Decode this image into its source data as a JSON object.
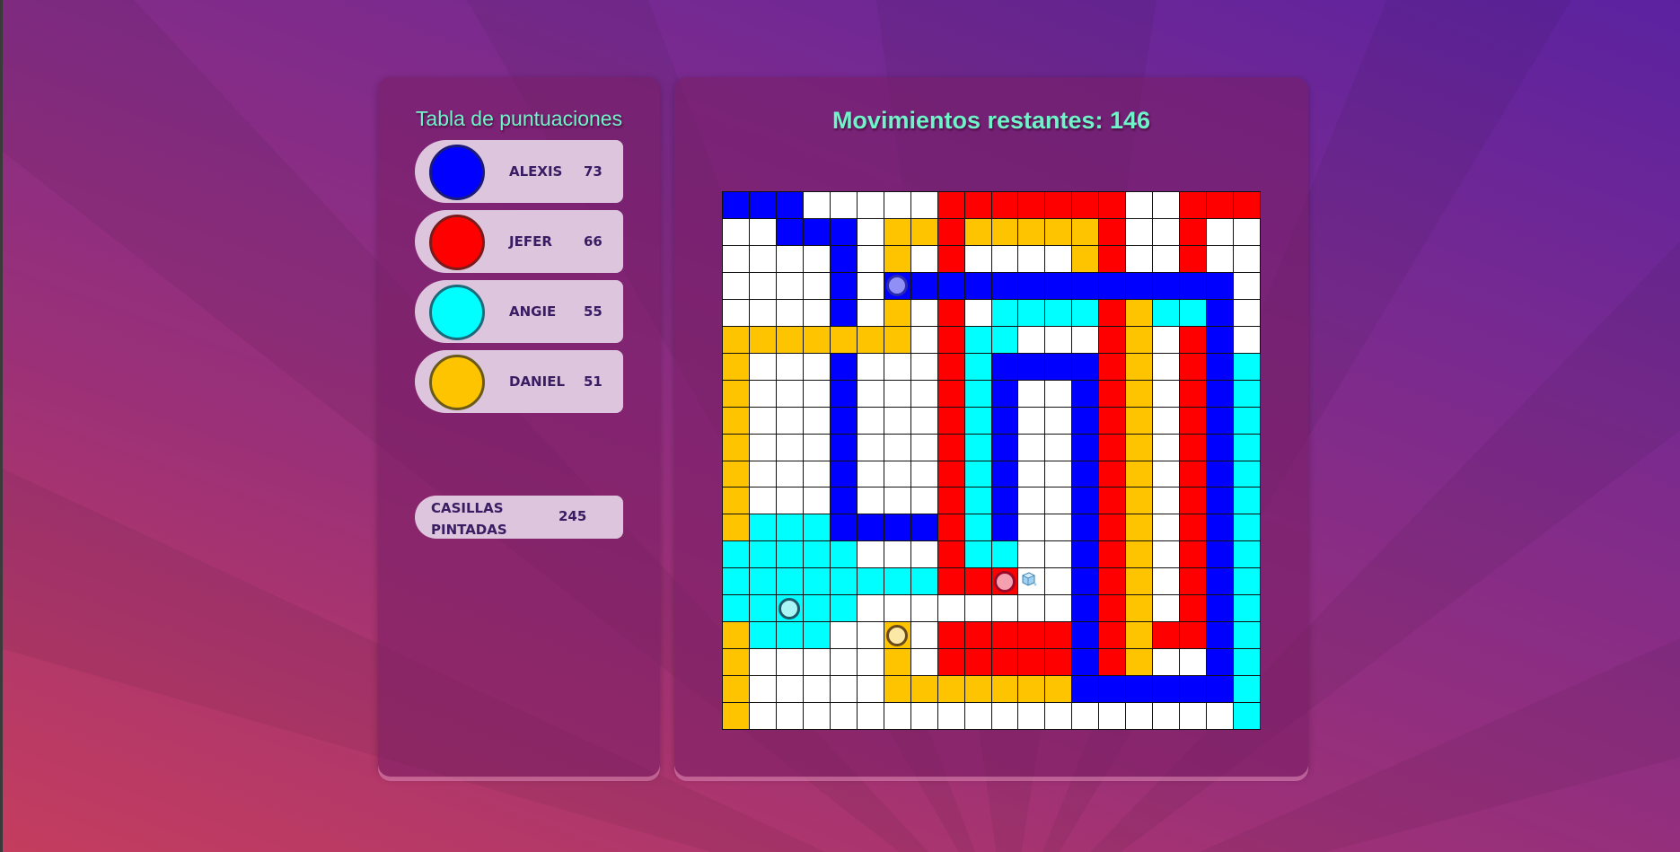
{
  "scoreboard": {
    "title": "Tabla de puntuaciones",
    "players": [
      {
        "name": "ALEXIS",
        "score": "73",
        "color": "#0000ff",
        "border": "#1a1a7a"
      },
      {
        "name": "JEFER",
        "score": "66",
        "color": "#ff0000",
        "border": "#7a1a1a"
      },
      {
        "name": "ANGIE",
        "score": "55",
        "color": "#00ffff",
        "border": "#1a6a7a"
      },
      {
        "name": "DANIEL",
        "score": "51",
        "color": "#ffc400",
        "border": "#6a5a1a"
      }
    ],
    "painted_label": "CASILLAS PINTADAS",
    "painted_value": "245"
  },
  "moves": {
    "label": "Movimientos restantes: 146"
  },
  "board": {
    "size": 20,
    "legend": {
      "B": "#0000ff",
      "R": "#ff0000",
      "C": "#00ffff",
      "Y": "#ffc400",
      "W": "#ffffff"
    },
    "rows": [
      "BBBWWWWWRRRRRRRWWRRR",
      "WWBBBWYYRYYYYYRWWRWW",
      "WWWWBWYWRWWWWYRWWRWW",
      "WWWWBWBBBBBBBBBBBBBW",
      "WWWWBWYWRWCCCCRYCCBW",
      "YYYYYYYWRCCWWWRYWRBW",
      "YWWWBWWWRCBBBBRYWRBC",
      "YWWWBWWWRCBWWBRYWRBC",
      "YWWWBWWWRCBWWBRYWRBC",
      "YWWWBWWWRCBWWBRYWRBC",
      "YWWWBWWWRCBWWBRYWRBC",
      "YWWWBWWWRCBWWBRYWRBC",
      "YCCCBBBBRCBWWBRYWRBC",
      "CCCCCWWWRCCWWBRYWRBC",
      "CCCCCCCCRRRWWBRYWRBC",
      "CCCCCWWWWWWWWBRYWRBC",
      "YCCCWWYWRRRRRBRYRRBC",
      "YWWWWWYWRRRRRBRYWWBC",
      "YWWWWWYYYYYYYBBBBBBC",
      "YWWWWWWWWWWWWWWWWWWC"
    ],
    "pieces": [
      {
        "name": "alexis-piece",
        "row": 3,
        "col": 6,
        "fill": "#8f8ff5",
        "stroke": "#2a2ab0"
      },
      {
        "name": "jefer-piece",
        "row": 14,
        "col": 10,
        "fill": "#f5a0b0",
        "stroke": "#9a0a2a"
      },
      {
        "name": "angie-piece",
        "row": 15,
        "col": 2,
        "fill": "#a8f5f5",
        "stroke": "#1a5a6a"
      },
      {
        "name": "daniel-piece",
        "row": 16,
        "col": 6,
        "fill": "#fbe7a6",
        "stroke": "#6a4a1a"
      }
    ],
    "bonus": {
      "row": 14,
      "col": 11,
      "icon": "ice-cube-icon"
    }
  }
}
